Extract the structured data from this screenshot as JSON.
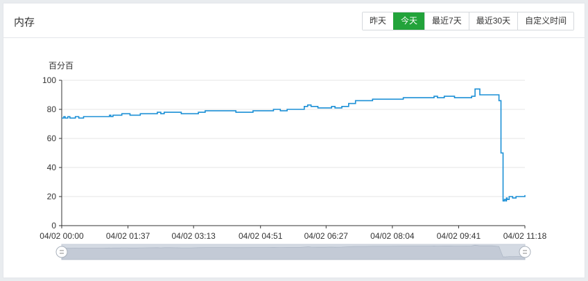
{
  "panel": {
    "title": "内存",
    "range_buttons": [
      {
        "label": "昨天",
        "active": false
      },
      {
        "label": "今天",
        "active": true
      },
      {
        "label": "最近7天",
        "active": false
      },
      {
        "label": "最近30天",
        "active": false
      },
      {
        "label": "自定义时间",
        "active": false
      }
    ]
  },
  "colors": {
    "line": "#1a8fd6",
    "active_button": "#22a33a",
    "grid": "#e6e6e6",
    "zoom_fill": "#d4dae3"
  },
  "chart_data": {
    "type": "line",
    "ylabel": "百分百",
    "ylim": [
      0,
      100
    ],
    "yticks": [
      0,
      20,
      40,
      60,
      80,
      100
    ],
    "x_range_minutes": [
      0,
      678
    ],
    "xticks": [
      {
        "label": "04/02 00:00",
        "minute": 0
      },
      {
        "label": "04/02 01:37",
        "minute": 97
      },
      {
        "label": "04/02 03:13",
        "minute": 193
      },
      {
        "label": "04/02 04:51",
        "minute": 291
      },
      {
        "label": "04/02 06:27",
        "minute": 387
      },
      {
        "label": "04/02 08:04",
        "minute": 484
      },
      {
        "label": "04/02 09:41",
        "minute": 581
      },
      {
        "label": "04/02 11:18",
        "minute": 678
      }
    ],
    "series": [
      {
        "x": [
          0,
          3,
          5,
          9,
          12,
          20,
          25,
          32,
          35,
          60,
          70,
          72,
          75,
          85,
          88,
          95,
          100,
          110,
          115,
          118,
          140,
          145,
          150,
          160,
          175,
          190,
          200,
          210,
          215,
          230,
          245,
          255,
          280,
          295,
          300,
          310,
          320,
          330,
          340,
          350,
          355,
          360,
          362,
          365,
          375,
          385,
          395,
          400,
          410,
          420,
          430,
          440,
          445,
          455,
          470,
          480,
          500,
          505,
          510,
          520,
          540,
          545,
          550,
          560,
          570,
          575,
          580,
          585,
          600,
          605,
          612,
          615,
          620,
          630,
          640,
          643,
          646,
          648,
          650,
          651,
          652,
          655,
          660,
          665,
          678
        ],
        "y": [
          74,
          75,
          74,
          75,
          74,
          75,
          74,
          75,
          75,
          75,
          76,
          75,
          76,
          76,
          77,
          77,
          76,
          76,
          77,
          77,
          78,
          77,
          78,
          78,
          77,
          77,
          78,
          79,
          79,
          79,
          79,
          78,
          79,
          79,
          79,
          80,
          79,
          80,
          80,
          80,
          82,
          83,
          83,
          82,
          81,
          81,
          82,
          81,
          82,
          84,
          86,
          86,
          86,
          87,
          87,
          87,
          88,
          88,
          88,
          88,
          88,
          89,
          88,
          89,
          89,
          88,
          88,
          88,
          89,
          94,
          90,
          90,
          90,
          90,
          86,
          50,
          17,
          18,
          17,
          19,
          18,
          20,
          19,
          20,
          21
        ]
      }
    ]
  }
}
